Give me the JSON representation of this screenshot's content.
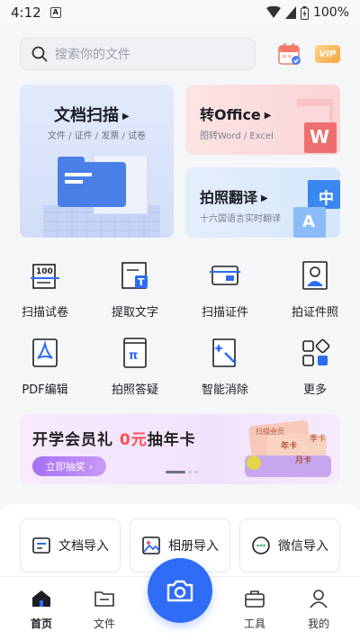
{
  "status": {
    "time": "4:12",
    "notif": "A",
    "battery": "100%"
  },
  "search": {
    "placeholder": "搜索你的文件"
  },
  "vip_label": "VIP",
  "cards": {
    "scan": {
      "title": "文档扫描",
      "sub": "文件 / 证件 / 发票 / 试卷"
    },
    "office": {
      "title": "转Office",
      "sub": "图转Word / Excel",
      "badge": "W"
    },
    "translate": {
      "title": "拍照翻译",
      "sub": "十六国语言实时翻译",
      "badge_zh": "中",
      "badge_a": "A"
    }
  },
  "tools": [
    {
      "label": "扫描试卷",
      "icon": "exam-scan-icon"
    },
    {
      "label": "提取文字",
      "icon": "extract-text-icon"
    },
    {
      "label": "扫描证件",
      "icon": "id-scan-icon"
    },
    {
      "label": "拍证件照",
      "icon": "id-photo-icon"
    },
    {
      "label": "PDF编辑",
      "icon": "pdf-edit-icon"
    },
    {
      "label": "拍照答疑",
      "icon": "photo-answer-icon"
    },
    {
      "label": "智能消除",
      "icon": "smart-erase-icon"
    },
    {
      "label": "更多",
      "icon": "more-icon"
    }
  ],
  "banner": {
    "title_a": "开学会员礼",
    "title_red": "0元",
    "title_b": "抽年卡",
    "button": "立即抽奖",
    "card_labels": [
      "扫描会员",
      "年卡",
      "季卡",
      "月卡"
    ]
  },
  "imports": [
    {
      "label": "文档导入",
      "icon": "doc-import-icon"
    },
    {
      "label": "相册导入",
      "icon": "album-import-icon"
    },
    {
      "label": "微信导入",
      "icon": "wechat-import-icon"
    }
  ],
  "tabs": [
    {
      "label": "首页",
      "icon": "home-icon",
      "active": true
    },
    {
      "label": "文件",
      "icon": "folder-icon"
    },
    {
      "label": "工具",
      "icon": "toolbox-icon"
    },
    {
      "label": "我的",
      "icon": "profile-icon"
    }
  ],
  "colors": {
    "accent": "#2e6cf6",
    "red": "#ff4d4f",
    "purple": "#a670f5"
  }
}
